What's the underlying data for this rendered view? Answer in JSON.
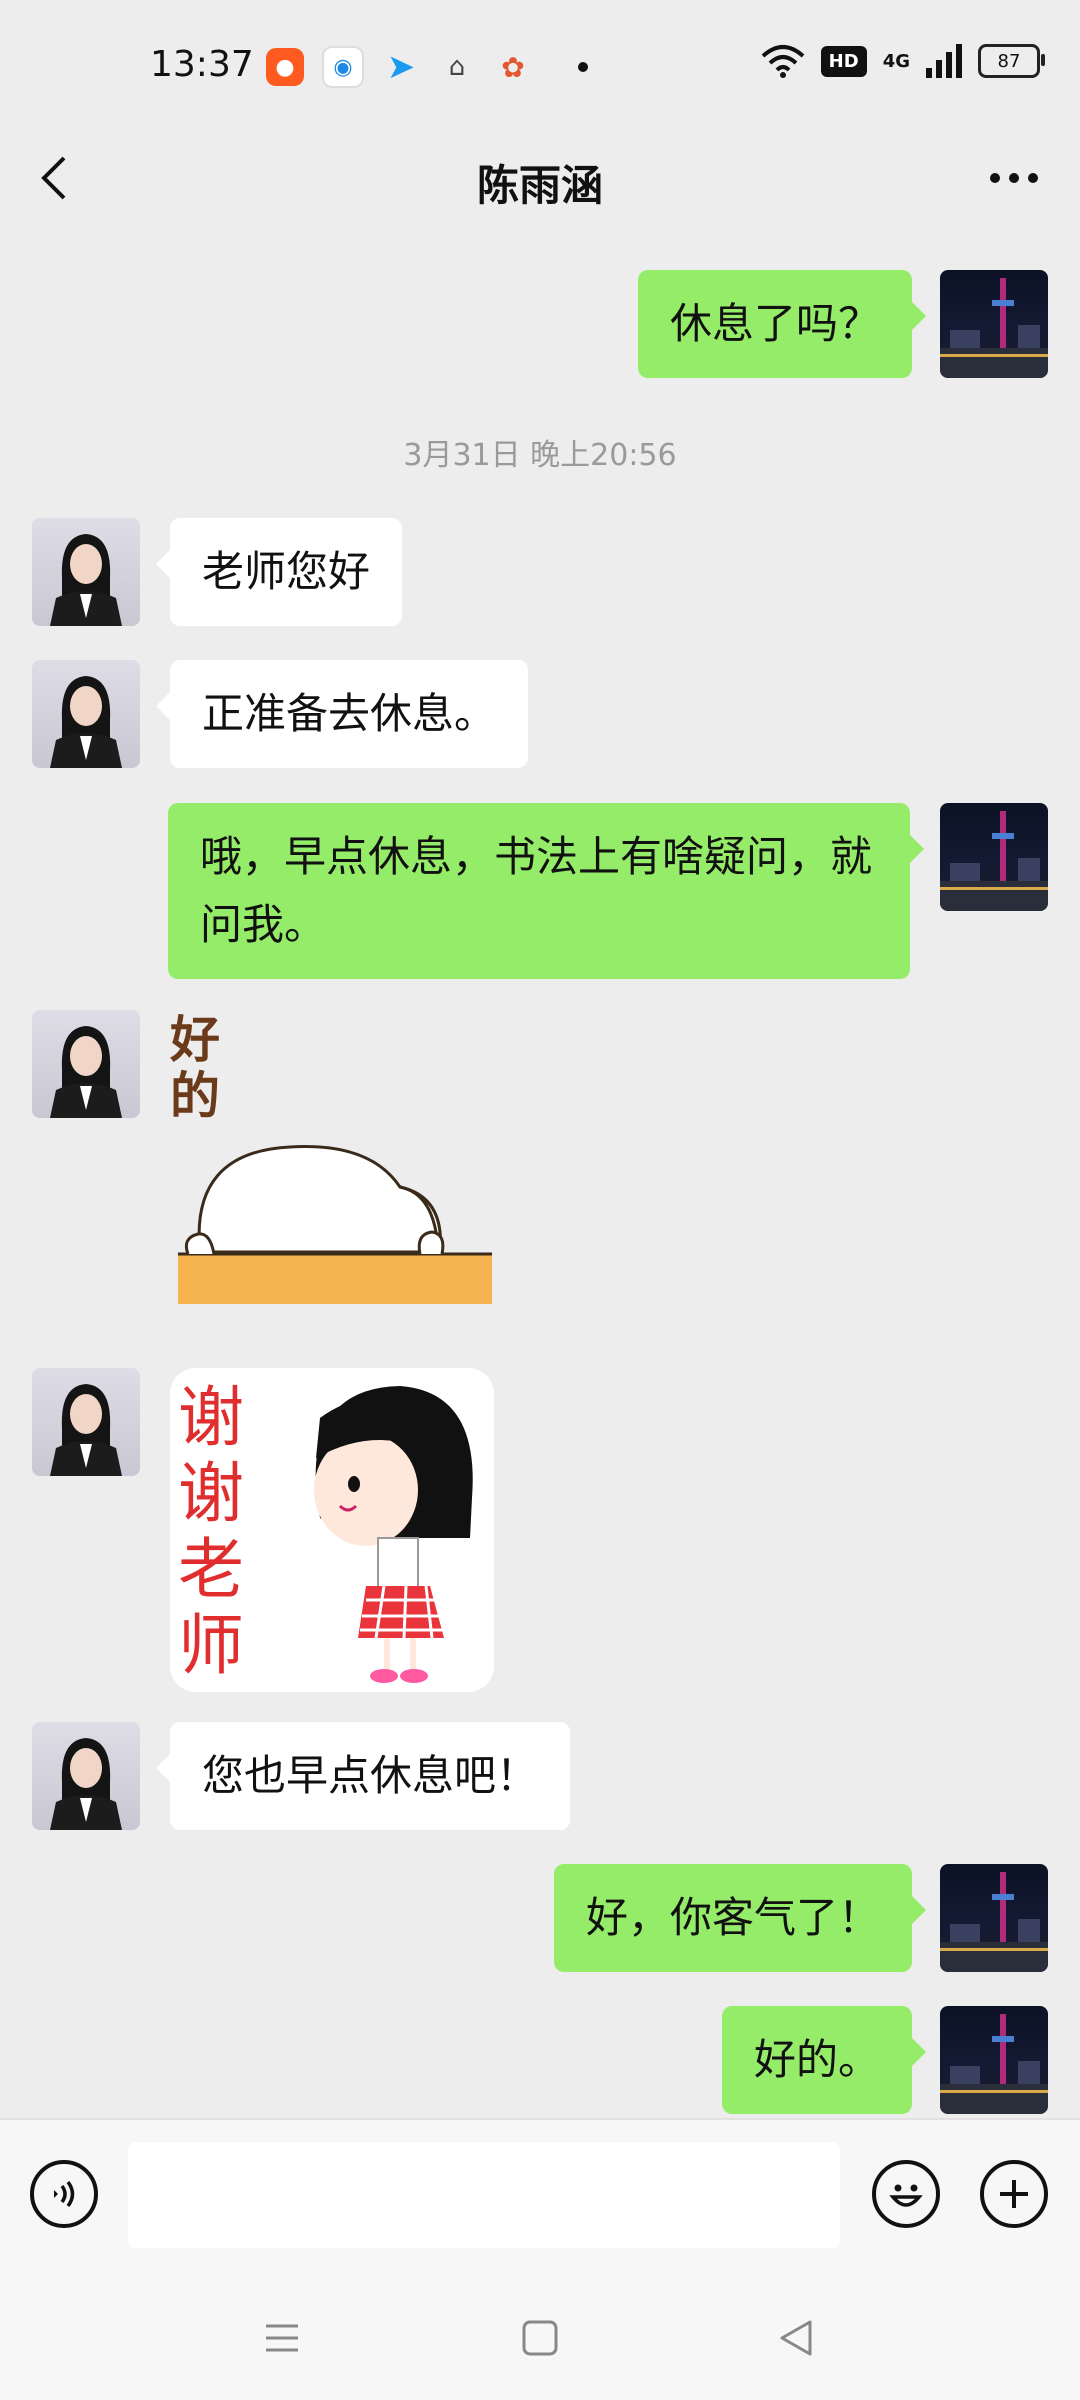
{
  "status_bar": {
    "time": "13:37",
    "hd": "HD",
    "network": "4G",
    "battery": "87"
  },
  "header": {
    "title": "陈雨涵"
  },
  "timestamp": "3月31日 晚上20:56",
  "messages": [
    {
      "side": "right",
      "text": "休息了吗？"
    },
    {
      "side": "left",
      "text": "老师您好"
    },
    {
      "side": "left",
      "text": "正准备去休息。"
    },
    {
      "side": "right",
      "text": "哦，早点休息，书法上有啥疑问，就问我。"
    },
    {
      "side": "left",
      "type": "sticker",
      "text": "好的"
    },
    {
      "side": "left",
      "type": "sticker",
      "text": "谢谢老师"
    },
    {
      "side": "left",
      "text": "您也早点休息吧！"
    },
    {
      "side": "right",
      "text": "好，你客气了！"
    },
    {
      "side": "right",
      "text": "好的。"
    }
  ],
  "input_bar": {
    "placeholder": ""
  },
  "icons": {
    "voice": "voice-icon",
    "emoji": "emoji-icon",
    "plus": "plus-icon",
    "menu": "menu-icon",
    "home": "home-icon",
    "back": "back-icon"
  },
  "colors": {
    "my_bubble": "#95ec69",
    "their_bubble": "#ffffff",
    "background": "#ededed"
  }
}
